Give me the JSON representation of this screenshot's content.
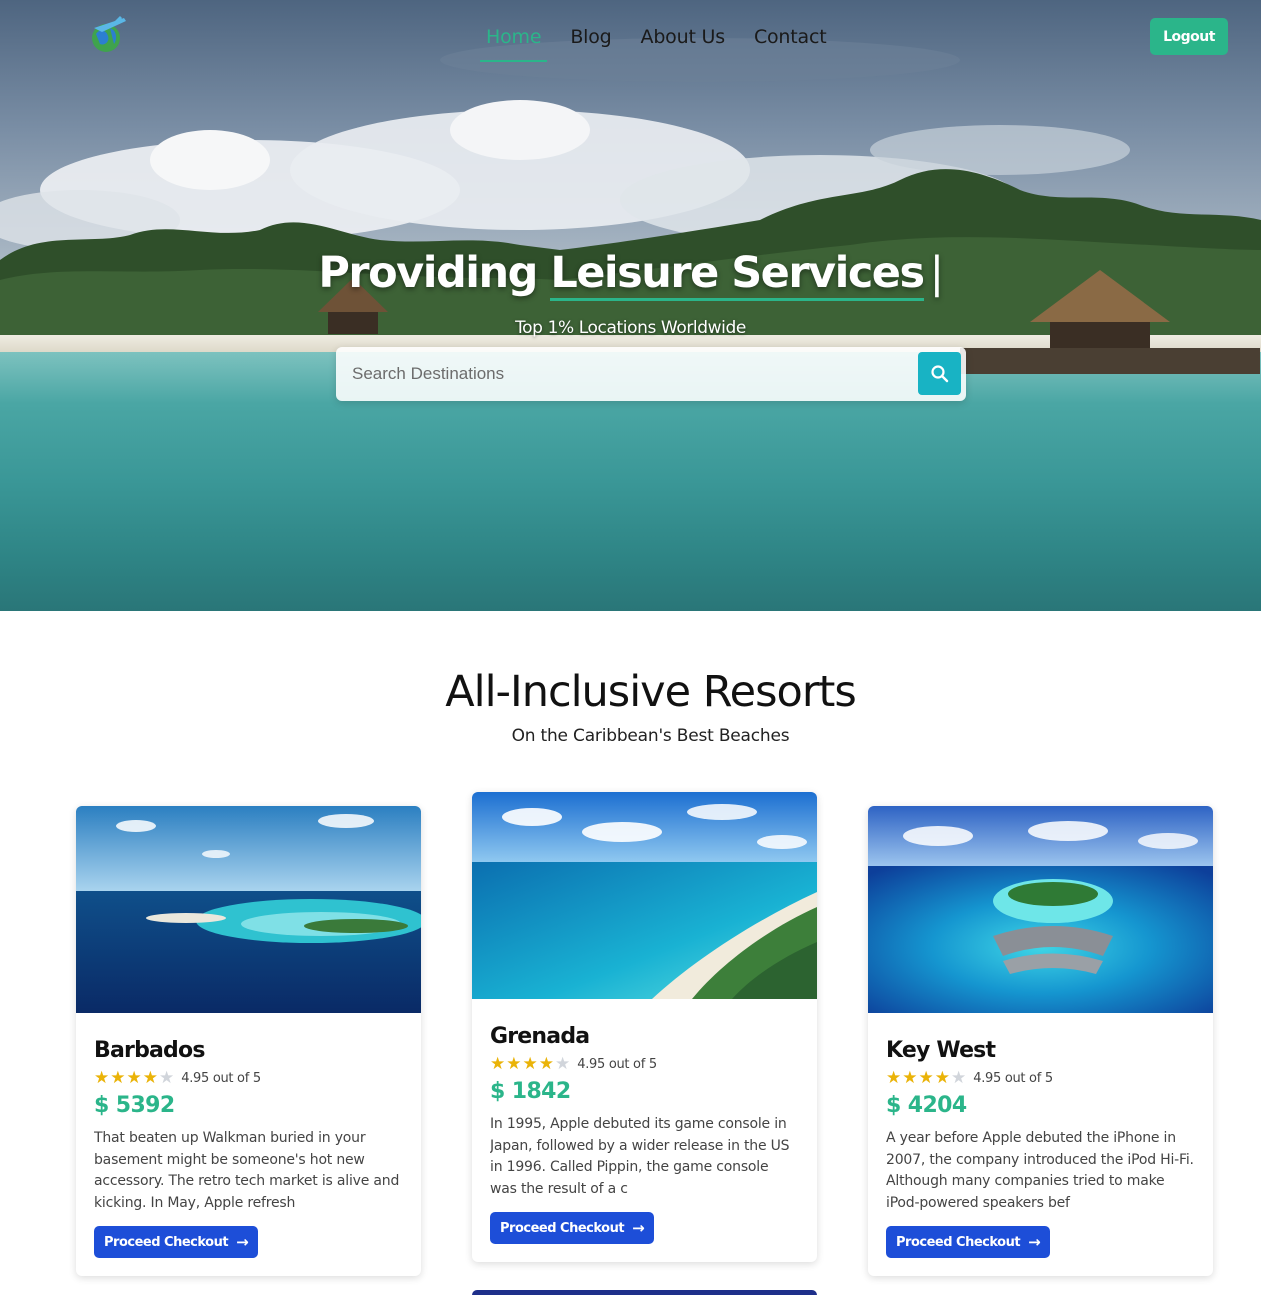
{
  "nav": {
    "items": [
      {
        "label": "Home",
        "active": true
      },
      {
        "label": "Blog",
        "active": false
      },
      {
        "label": "About Us",
        "active": false
      },
      {
        "label": "Contact",
        "active": false
      }
    ],
    "logout_label": "Logout"
  },
  "hero": {
    "title_static": "Providing",
    "title_typed": "Leisure Services",
    "cursor": "|",
    "subtitle": "Top 1% Locations Worldwide",
    "search_placeholder": "Search Destinations"
  },
  "section": {
    "title": "All-Inclusive Resorts",
    "subtitle": "On the Caribbean's Best Beaches"
  },
  "cards": [
    {
      "name": "Barbados",
      "rating_text": "4.95 out of 5",
      "stars_filled": 4,
      "stars_total": 5,
      "price": "$ 5392",
      "description": "That beaten up Walkman buried in your basement might be someone's hot new accessory. The retro tech market is alive and kicking. In May, Apple refresh",
      "button_label": "Proceed Checkout"
    },
    {
      "name": "Grenada",
      "rating_text": "4.95 out of 5",
      "stars_filled": 4,
      "stars_total": 5,
      "price": "$ 1842",
      "description": "In 1995, Apple debuted its game console in Japan, followed by a wider release in the US in 1996. Called Pippin, the game console was the result of a c",
      "button_label": "Proceed Checkout"
    },
    {
      "name": "Key West",
      "rating_text": "4.95 out of 5",
      "stars_filled": 4,
      "stars_total": 5,
      "price": "$ 4204",
      "description": "A year before Apple debuted the iPhone in 2007, the company introduced the iPod Hi-Fi. Although many companies tried to make iPod-powered speakers bef",
      "button_label": "Proceed Checkout"
    }
  ],
  "colors": {
    "accent": "#2bb58a",
    "search_button": "#18b3c4",
    "checkout_button": "#1d4ed8",
    "star": "#eab308",
    "star_off": "#d1d5db"
  },
  "icons": {
    "logo": "globe-airplane-logo",
    "search": "search-icon",
    "arrow": "arrow-right-icon"
  }
}
